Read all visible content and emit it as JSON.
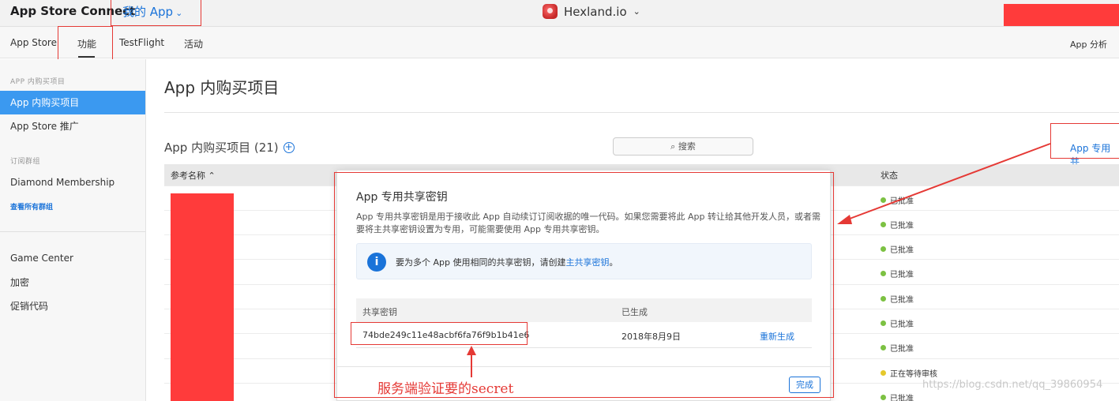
{
  "topbar": {
    "brand": "App Store Connect",
    "my_apps": "我的 App",
    "app_name": "Hexland.io"
  },
  "subnav": {
    "items": [
      "App Store",
      "功能",
      "TestFlight",
      "活动"
    ],
    "right": "App 分析"
  },
  "sidebar": {
    "section1_heading": "APP 内购买项目",
    "item_iap": "App 内购买项目",
    "item_promo": "App Store 推广",
    "section2_heading": "订阅群组",
    "item_diamond": "Diamond Membership",
    "view_all_groups": "查看所有群组",
    "item_gamecenter": "Game Center",
    "item_encryption": "加密",
    "item_promo_codes": "促销代码"
  },
  "main": {
    "page_title": "App 内购买项目",
    "section_title": "App 内购买项目 (21)",
    "search_placeholder": "搜索",
    "shared_secret_link": "App 专用共",
    "col_reference": "参考名称 ⌃",
    "col_status": "状态",
    "statuses": [
      {
        "text": "已批准",
        "color": "#7cc142"
      },
      {
        "text": "已批准",
        "color": "#7cc142"
      },
      {
        "text": "已批准",
        "color": "#7cc142"
      },
      {
        "text": "已批准",
        "color": "#7cc142"
      },
      {
        "text": "已批准",
        "color": "#7cc142"
      },
      {
        "text": "已批准",
        "color": "#7cc142"
      },
      {
        "text": "已批准",
        "color": "#7cc142"
      },
      {
        "text": "正在等待审核",
        "color": "#e5c82b"
      },
      {
        "text": "已批准",
        "color": "#7cc142"
      }
    ]
  },
  "modal": {
    "title": "App 专用共享密钥",
    "desc": "App 专用共享密钥是用于接收此 App 自动续订订阅收据的唯一代码。如果您需要将此 App 转让给其他开发人员，或者需要将主共享密钥设置为专用，可能需要使用 App 专用共享密钥。",
    "info_text": "要为多个 App 使用相同的共享密钥，请创建",
    "info_link": "主共享密钥",
    "info_end": "。",
    "col_key": "共享密钥",
    "col_generated": "已生成",
    "key_value": "74bde249c11e48acbf6fa76f9b1b41e6",
    "generated_date": "2018年8月9日",
    "regenerate": "重新生成",
    "done": "完成"
  },
  "annotation": "服务端验证要的secret",
  "watermark": "https://blog.csdn.net/qq_39860954",
  "colors": {
    "accent": "#1a73d9",
    "annotation_red": "#e53935",
    "sidebar_active": "#3b99f0"
  }
}
